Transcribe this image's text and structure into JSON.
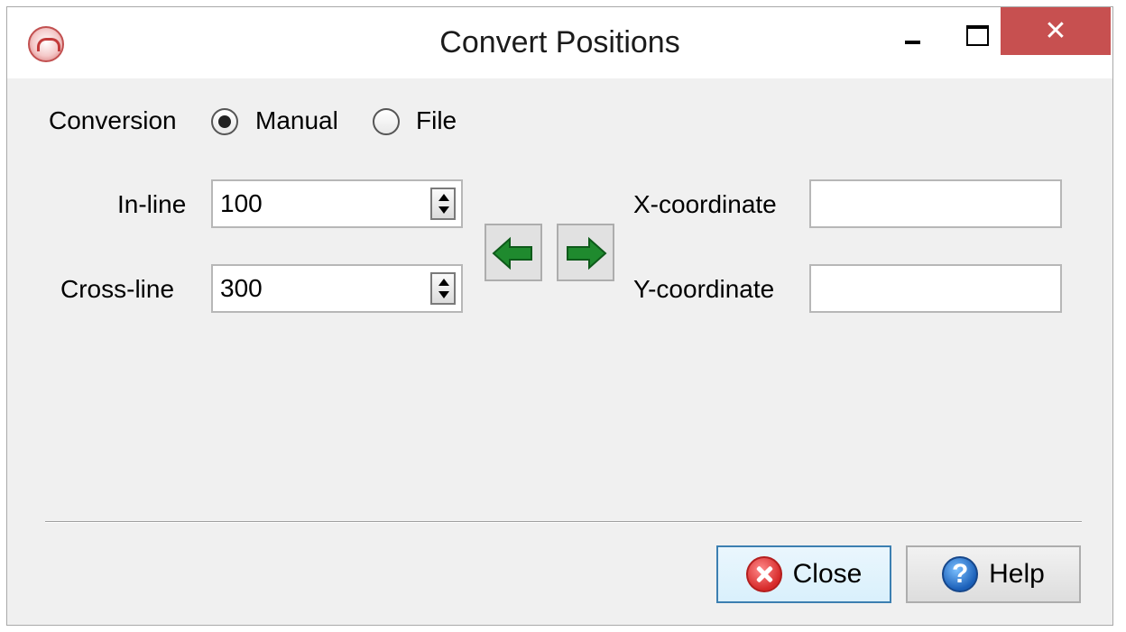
{
  "window": {
    "title": "Convert Positions",
    "close_glyph": "✕",
    "app_icon": "seismic-app-icon"
  },
  "conversion": {
    "label": "Conversion",
    "options": [
      {
        "label": "Manual",
        "selected": true
      },
      {
        "label": "File",
        "selected": false
      }
    ]
  },
  "inputs": {
    "inline_label": "In-line",
    "inline_value": "100",
    "crossline_label": "Cross-line",
    "crossline_value": "300",
    "x_label": "X-coordinate",
    "x_value": "",
    "y_label": "Y-coordinate",
    "y_value": ""
  },
  "arrows": {
    "left_icon": "green-left-arrow-icon",
    "right_icon": "green-right-arrow-icon"
  },
  "footer": {
    "close_label": "Close",
    "help_label": "Help",
    "help_glyph": "?"
  },
  "colors": {
    "close_bar": "#c75050",
    "arrow_green": "#1f8a2e",
    "default_button_border": "#3c7fb1"
  }
}
